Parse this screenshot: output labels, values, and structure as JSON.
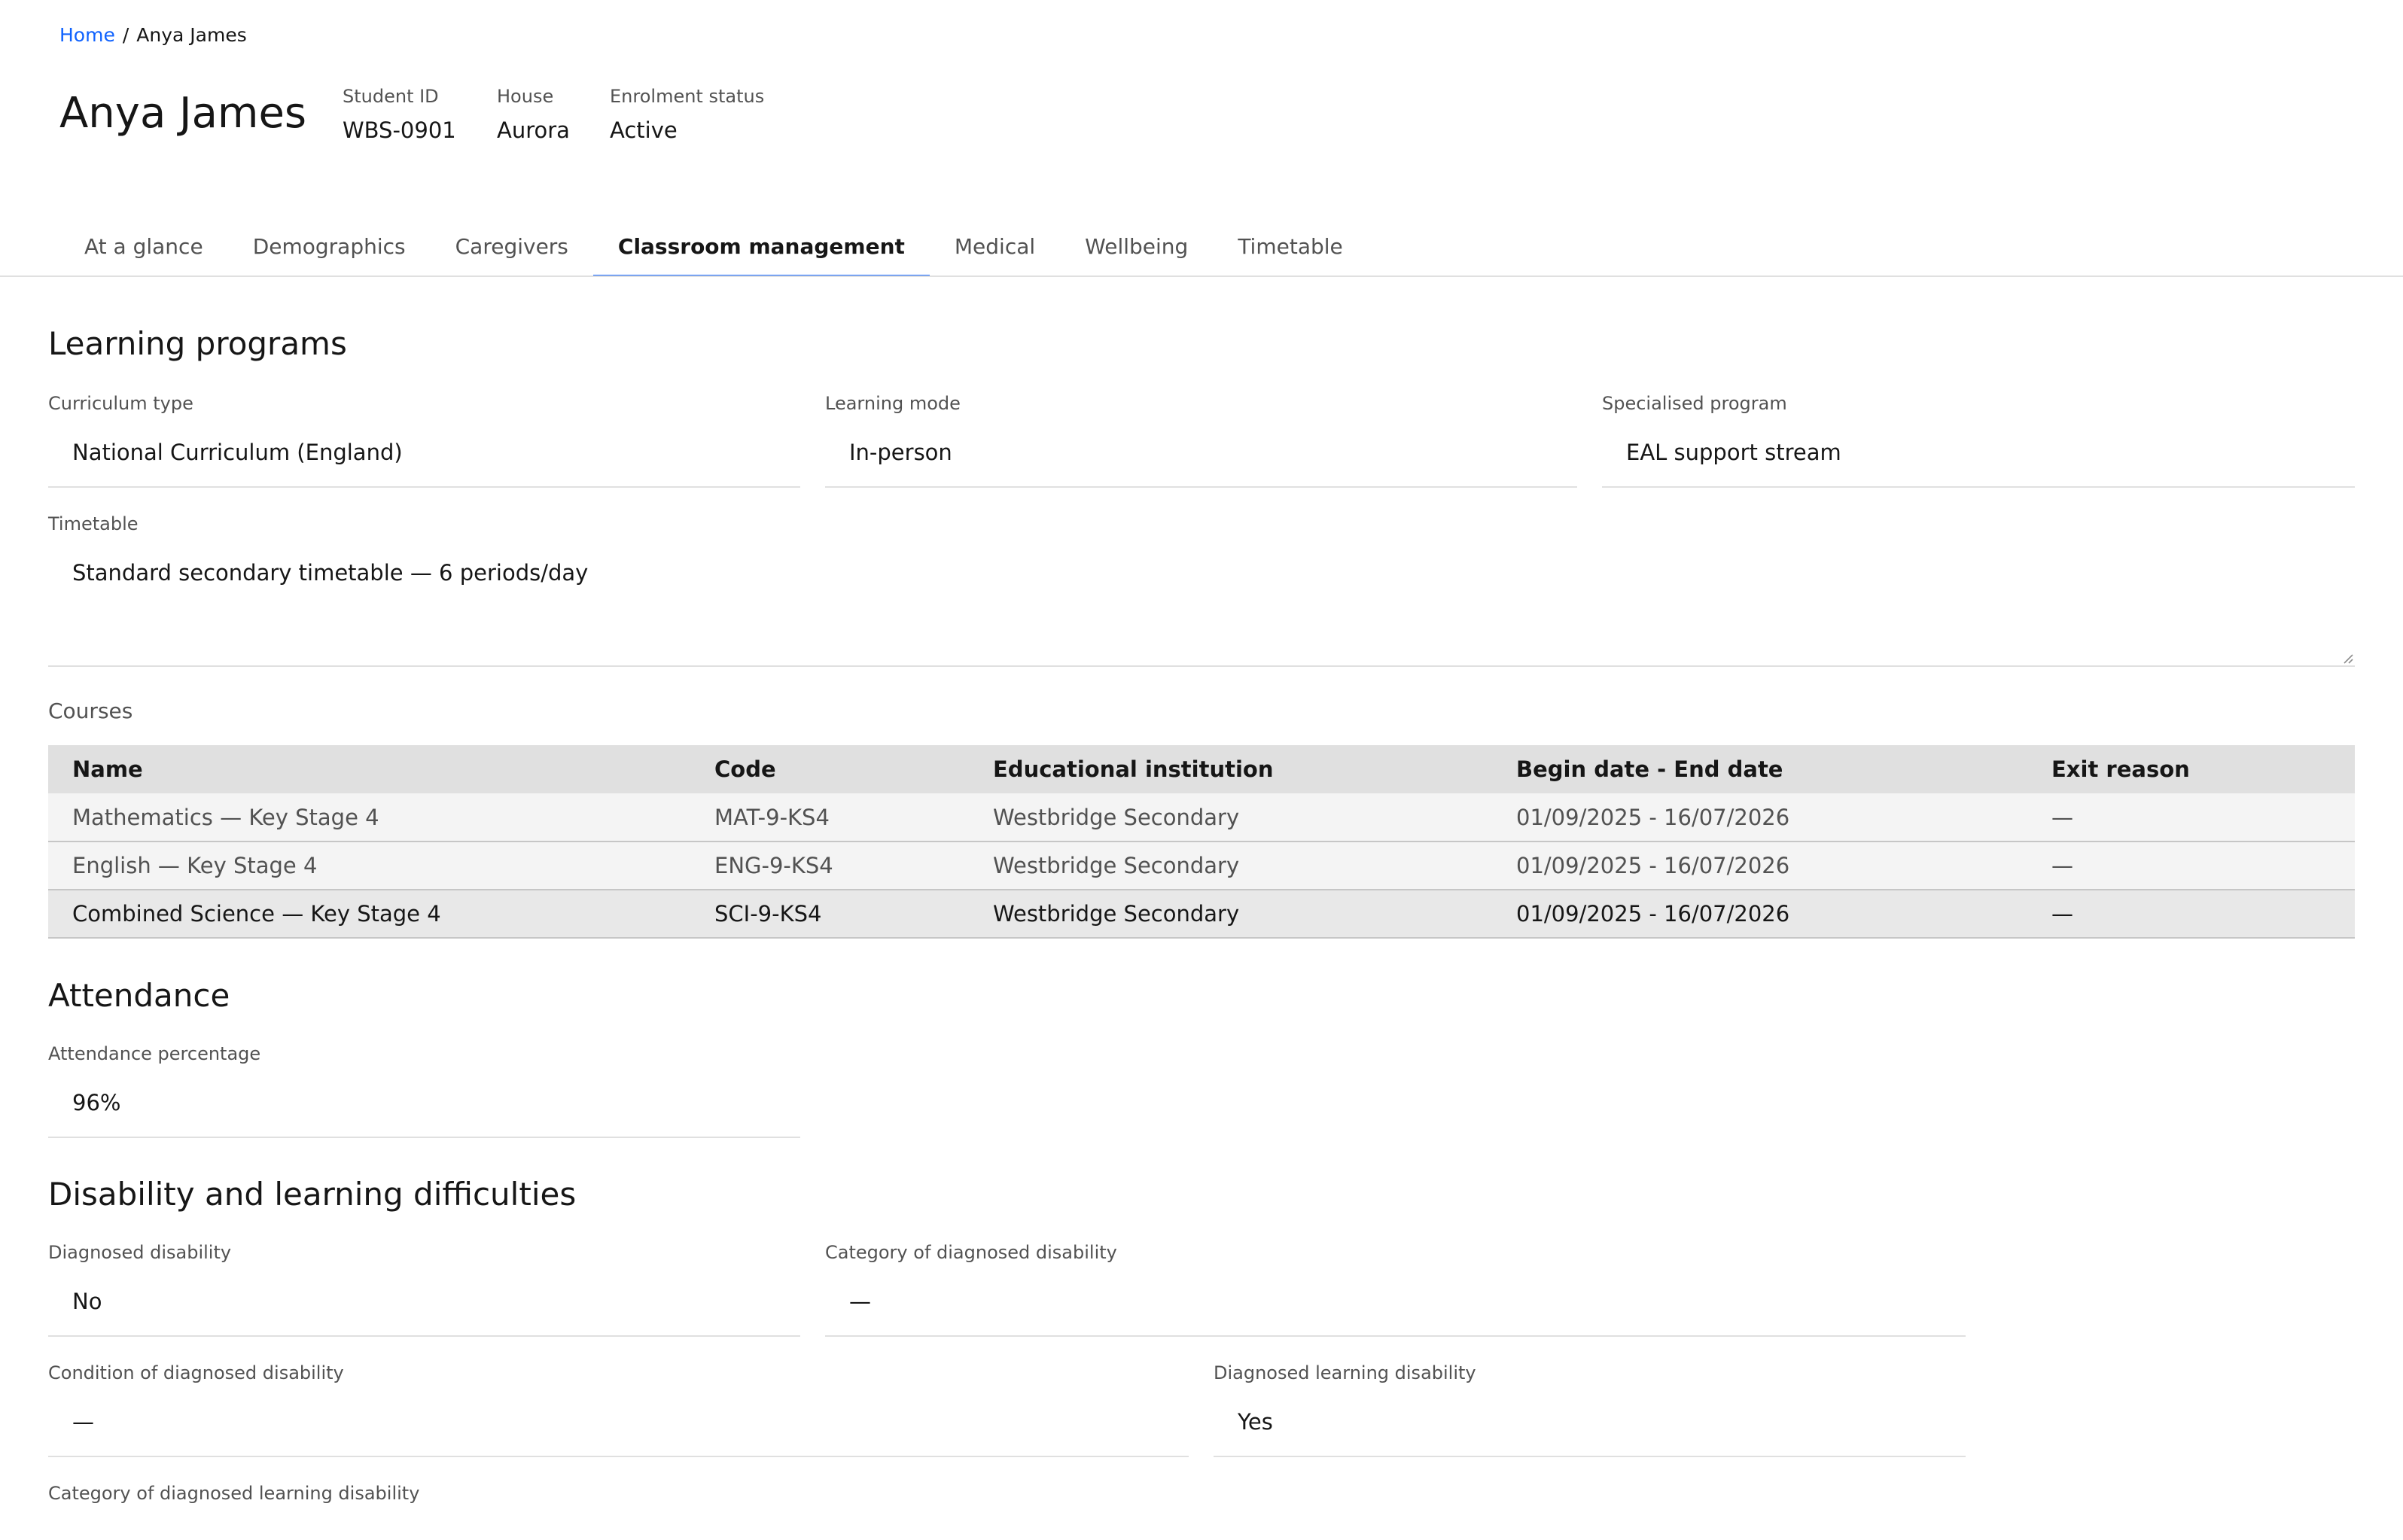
{
  "breadcrumb": {
    "home": "Home",
    "current": "Anya James"
  },
  "student": {
    "name": "Anya James",
    "meta": [
      {
        "label": "Student ID",
        "value": "WBS-0901"
      },
      {
        "label": "House",
        "value": "Aurora"
      },
      {
        "label": "Enrolment status",
        "value": "Active"
      }
    ]
  },
  "tabs": [
    "At a glance",
    "Demographics",
    "Caregivers",
    "Classroom management",
    "Medical",
    "Wellbeing",
    "Timetable"
  ],
  "learning_programs": {
    "title": "Learning programs",
    "curriculum_type": {
      "label": "Curriculum type",
      "value": "National Curriculum (England)"
    },
    "learning_mode": {
      "label": "Learning mode",
      "value": "In-person"
    },
    "specialised_program": {
      "label": "Specialised program",
      "value": "EAL support stream"
    },
    "timetable": {
      "label": "Timetable",
      "value": "Standard secondary timetable — 6 periods/day"
    }
  },
  "courses": {
    "label": "Courses",
    "columns": [
      "Name",
      "Code",
      "Educational institution",
      "Begin date - End date",
      "Exit reason"
    ],
    "rows": [
      [
        "Mathematics — Key Stage 4",
        "MAT-9-KS4",
        "Westbridge Secondary",
        "01/09/2025 - 16/07/2026",
        "—"
      ],
      [
        "English — Key Stage 4",
        "ENG-9-KS4",
        "Westbridge Secondary",
        "01/09/2025 - 16/07/2026",
        "—"
      ],
      [
        "Combined Science — Key Stage 4",
        "SCI-9-KS4",
        "Westbridge Secondary",
        "01/09/2025 - 16/07/2026",
        "—"
      ]
    ]
  },
  "attendance": {
    "title": "Attendance",
    "percentage": {
      "label": "Attendance percentage",
      "value": "96%"
    }
  },
  "disability": {
    "title": "Disability and learning difficulties",
    "diagnosed_disability": {
      "label": "Diagnosed disability",
      "value": "No"
    },
    "category_disability": {
      "label": "Category of diagnosed disability",
      "value": "—"
    },
    "condition_disability": {
      "label": "Condition of diagnosed disability",
      "value": "—"
    },
    "diagnosed_learning": {
      "label": "Diagnosed learning disability",
      "value": "Yes"
    },
    "category_learning": {
      "label": "Category of diagnosed learning disability"
    }
  }
}
